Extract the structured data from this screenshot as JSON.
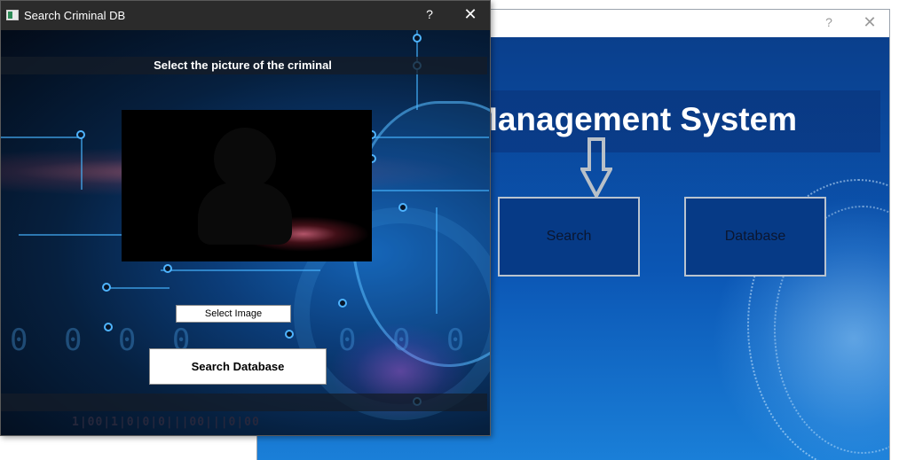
{
  "main_window": {
    "help_glyph": "?",
    "close_glyph": "✕",
    "heading": "Management System",
    "buttons": {
      "search": "Search",
      "database": "Database"
    }
  },
  "dialog": {
    "title": "Search Criminal DB",
    "help_glyph": "?",
    "close_glyph": "✕",
    "instruction": "Select the picture of the criminal",
    "select_image_label": "Select Image",
    "search_database_label": "Search Database",
    "binary_text": "1|00|1|0|0|0|||00|||0|00"
  },
  "icons": {
    "app_icon": "app-window-icon",
    "avatar": "person-silhouette-icon",
    "arrow": "down-arrow-icon"
  },
  "colors": {
    "dialog_titlebar": "#2b2b2b",
    "main_accent": "#0b56b4",
    "tile_fill": "#063a86"
  }
}
